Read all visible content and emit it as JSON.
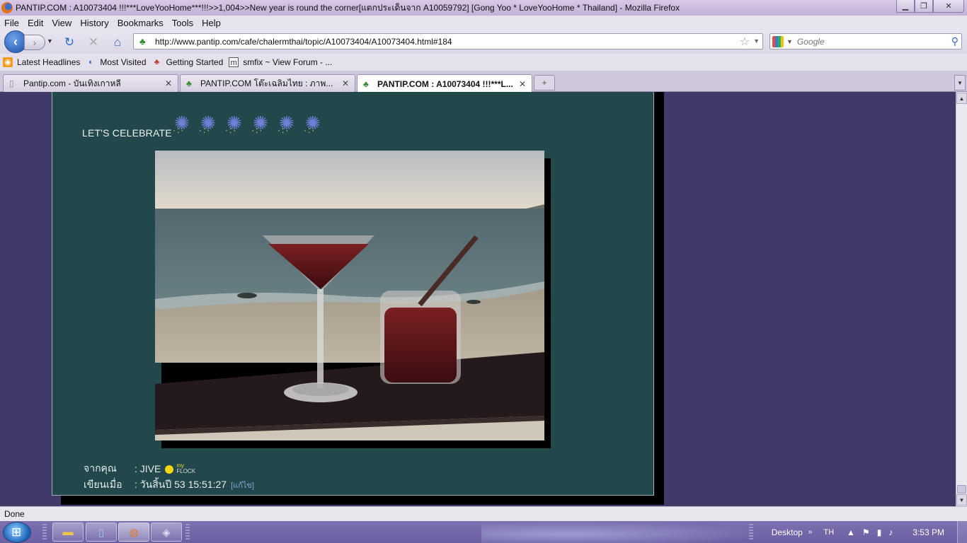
{
  "window": {
    "title": "PANTIP.COM : A10073404 !!!***LoveYooHome***!!!>>1,004>>New year is round the corner[แตกประเด็นจาก A10059792] [Gong Yoo * LoveYooHome * Thailand] - Mozilla Firefox"
  },
  "menu": [
    "File",
    "Edit",
    "View",
    "History",
    "Bookmarks",
    "Tools",
    "Help"
  ],
  "nav": {
    "url": "http://www.pantip.com/cafe/chalermthai/topic/A10073404/A10073404.html#184",
    "search_placeholder": "Google"
  },
  "bookmarks": [
    {
      "label": "Latest Headlines",
      "icon": "rss-icon"
    },
    {
      "label": "Most Visited",
      "icon": "most-visited-icon"
    },
    {
      "label": "Getting Started",
      "icon": "getting-started-icon"
    },
    {
      "label": "smfix ~ View Forum - ...",
      "icon": "page-icon"
    }
  ],
  "tabs": [
    {
      "label": "Pantip.com - บันเทิงเกาหลี",
      "icon": "document-icon",
      "active": false
    },
    {
      "label": "PANTIP.COM โต๊ะเฉลิมไทย : ภาพ...",
      "icon": "pantip-icon",
      "active": false
    },
    {
      "label": "PANTIP.COM : A10073404 !!!***L...",
      "icon": "pantip-icon",
      "active": true
    }
  ],
  "post": {
    "heading": "LET'S CELEBRATE",
    "from_label": "จากคุณ",
    "from_value": ": JIVE",
    "myflock_top": "my",
    "myflock_bottom": "FLOCK",
    "written_label": "เขียนเมื่อ",
    "written_value": ": วันสิ้นปี 53 15:51:27",
    "edit_link": "[แก้ไข]"
  },
  "status": {
    "text": "Done"
  },
  "taskbar": {
    "desktop_label": "Desktop",
    "chevron": "»",
    "language": "TH",
    "clock": "3:53 PM"
  },
  "colors": {
    "page_bg": "#3f3a68",
    "post_bg": "#22484b",
    "titlebar": "#c3b0d6"
  }
}
